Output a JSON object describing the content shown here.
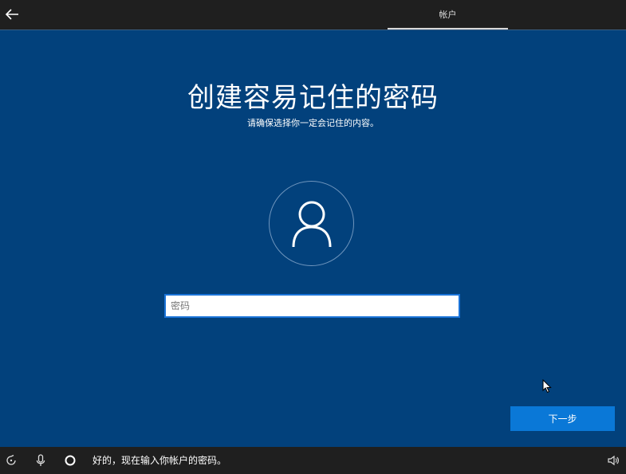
{
  "header": {
    "back_icon": "back-arrow-icon",
    "tab_label": "帐户"
  },
  "main": {
    "title": "创建容易记住的密码",
    "subtitle": "请确保选择你一定会记住的内容。",
    "avatar_icon": "user-icon",
    "password_placeholder": "密码",
    "password_value": "",
    "next_label": "下一步"
  },
  "footer": {
    "ease_of_access_icon": "ease-of-access-icon",
    "mic_icon": "microphone-icon",
    "cortana_icon": "cortana-circle-icon",
    "assistant_message": "好的，现在输入你帐户的密码。",
    "volume_icon": "volume-icon"
  },
  "colors": {
    "background": "#02417c",
    "topbar": "#1f1f1f",
    "accent_button": "#0a78d7",
    "input_border": "#1a73d8"
  }
}
